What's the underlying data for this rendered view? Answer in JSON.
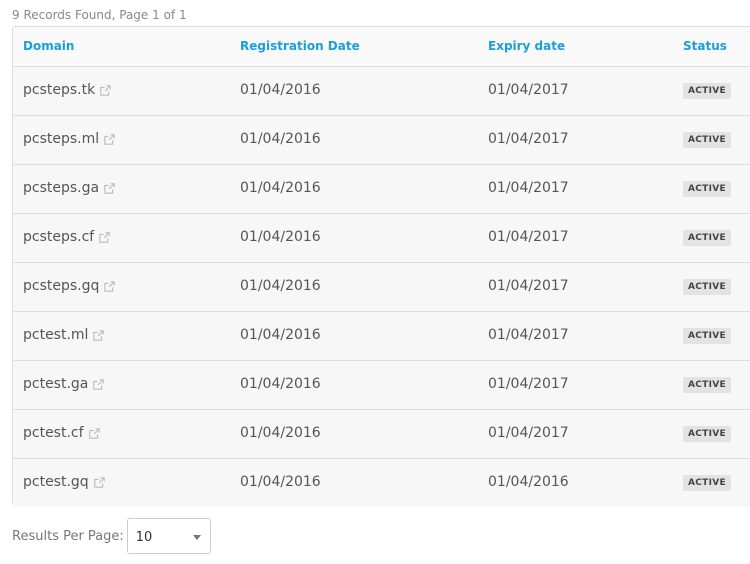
{
  "summary": "9 Records Found, Page 1 of 1",
  "table": {
    "headers": {
      "domain": "Domain",
      "registration": "Registration Date",
      "expiry": "Expiry date",
      "status": "Status"
    },
    "rows": [
      {
        "domain": "pcsteps.tk",
        "registration": "01/04/2016",
        "expiry": "01/04/2017",
        "status": "ACTIVE"
      },
      {
        "domain": "pcsteps.ml",
        "registration": "01/04/2016",
        "expiry": "01/04/2017",
        "status": "ACTIVE"
      },
      {
        "domain": "pcsteps.ga",
        "registration": "01/04/2016",
        "expiry": "01/04/2017",
        "status": "ACTIVE"
      },
      {
        "domain": "pcsteps.cf",
        "registration": "01/04/2016",
        "expiry": "01/04/2017",
        "status": "ACTIVE"
      },
      {
        "domain": "pcsteps.gq",
        "registration": "01/04/2016",
        "expiry": "01/04/2017",
        "status": "ACTIVE"
      },
      {
        "domain": "pctest.ml",
        "registration": "01/04/2016",
        "expiry": "01/04/2017",
        "status": "ACTIVE"
      },
      {
        "domain": "pctest.ga",
        "registration": "01/04/2016",
        "expiry": "01/04/2017",
        "status": "ACTIVE"
      },
      {
        "domain": "pctest.cf",
        "registration": "01/04/2016",
        "expiry": "01/04/2017",
        "status": "ACTIVE"
      },
      {
        "domain": "pctest.gq",
        "registration": "01/04/2016",
        "expiry": "01/04/2016",
        "status": "ACTIVE"
      }
    ]
  },
  "footer": {
    "results_per_page_label": "Results Per Page:",
    "results_per_page_value": "10"
  },
  "icons": {
    "domain_link": "external-link-icon",
    "select_caret": "chevron-down-icon"
  },
  "colors": {
    "header_text": "#1a9fd8",
    "badge_bg": "#e3e3e3"
  }
}
